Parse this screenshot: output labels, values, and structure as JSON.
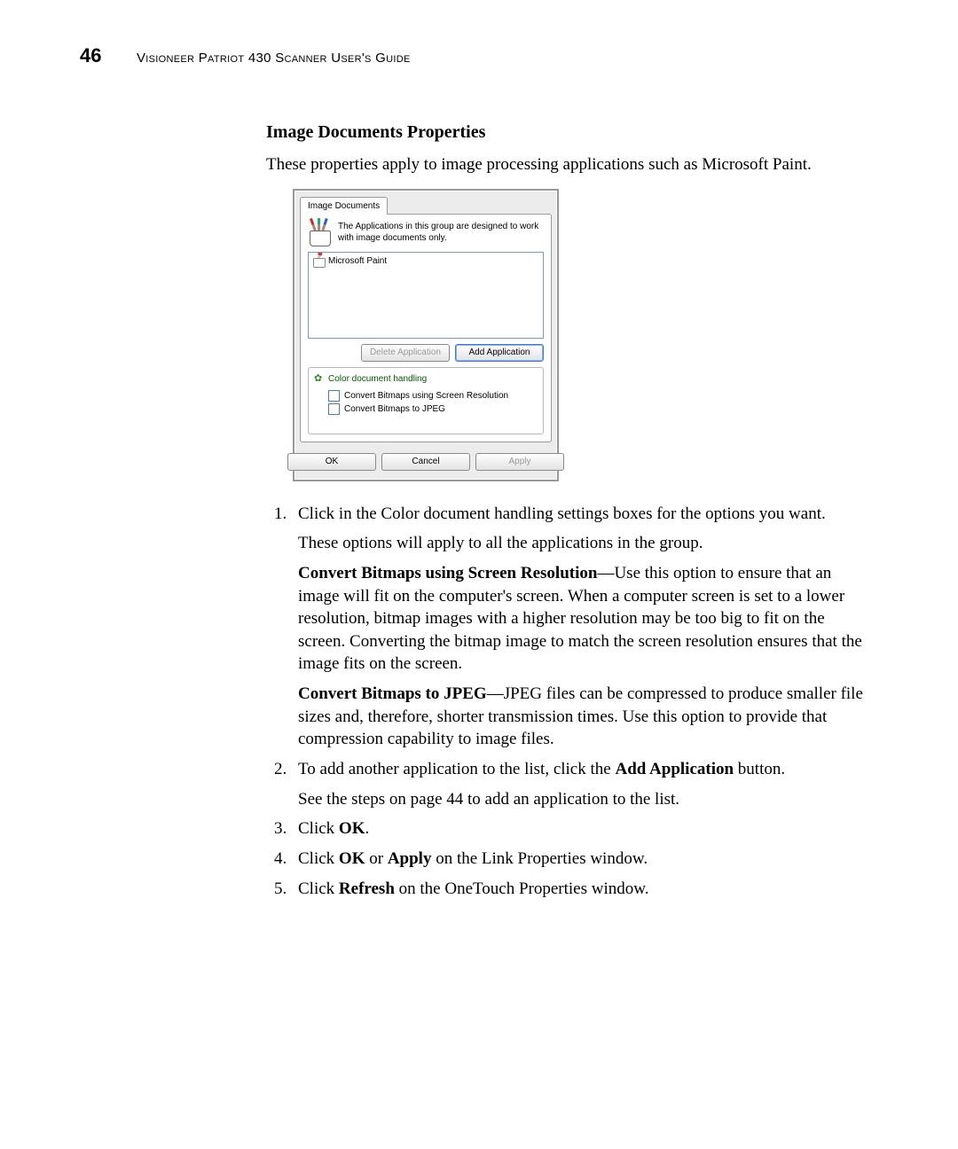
{
  "header": {
    "page_number": "46",
    "running_head": "Visioneer Patriot 430 Scanner User's Guide"
  },
  "section": {
    "heading": "Image Documents Properties",
    "intro": "These properties apply to image processing applications such as Microsoft Paint."
  },
  "dialog": {
    "tab_label": "Image Documents",
    "description": "The Applications in this group are designed to work with image documents only.",
    "app_list_item": "Microsoft Paint",
    "delete_btn": "Delete Application",
    "add_btn": "Add Application",
    "group_title": "Color document handling",
    "opt1": "Convert Bitmaps using Screen Resolution",
    "opt2": "Convert Bitmaps to JPEG",
    "ok": "OK",
    "cancel": "Cancel",
    "apply": "Apply"
  },
  "steps": {
    "s1_text": "Click in the Color document handling settings boxes for the options you want.",
    "s1_sub1": "These options will apply to all the applications in the group.",
    "s1_opt1_title": "Convert Bitmaps using Screen Resolution",
    "s1_opt1_body": "—Use this option to ensure that an image will fit on the computer's screen. When a computer screen is set to a lower resolution, bitmap images with a higher resolution may be too big to fit on the screen. Converting the bitmap image to match the screen resolution ensures that the image fits on the screen.",
    "s1_opt2_title": "Convert Bitmaps to JPEG",
    "s1_opt2_body": "—JPEG files can be compressed to produce smaller file sizes and, therefore, shorter transmission times. Use this option to provide that compression capability to image files.",
    "s2_pre": "To add another application to the list, click the ",
    "s2_bold": "Add Application",
    "s2_post": " button.",
    "s2_sub": "See the steps on page 44 to add an application to the list.",
    "s3_pre": "Click ",
    "s3_bold": "OK",
    "s3_post": ".",
    "s4_pre": "Click ",
    "s4_bold1": "OK",
    "s4_mid": " or ",
    "s4_bold2": "Apply",
    "s4_post": " on the Link Properties window.",
    "s5_pre": "Click ",
    "s5_bold": "Refresh",
    "s5_post": " on the OneTouch Properties window."
  }
}
